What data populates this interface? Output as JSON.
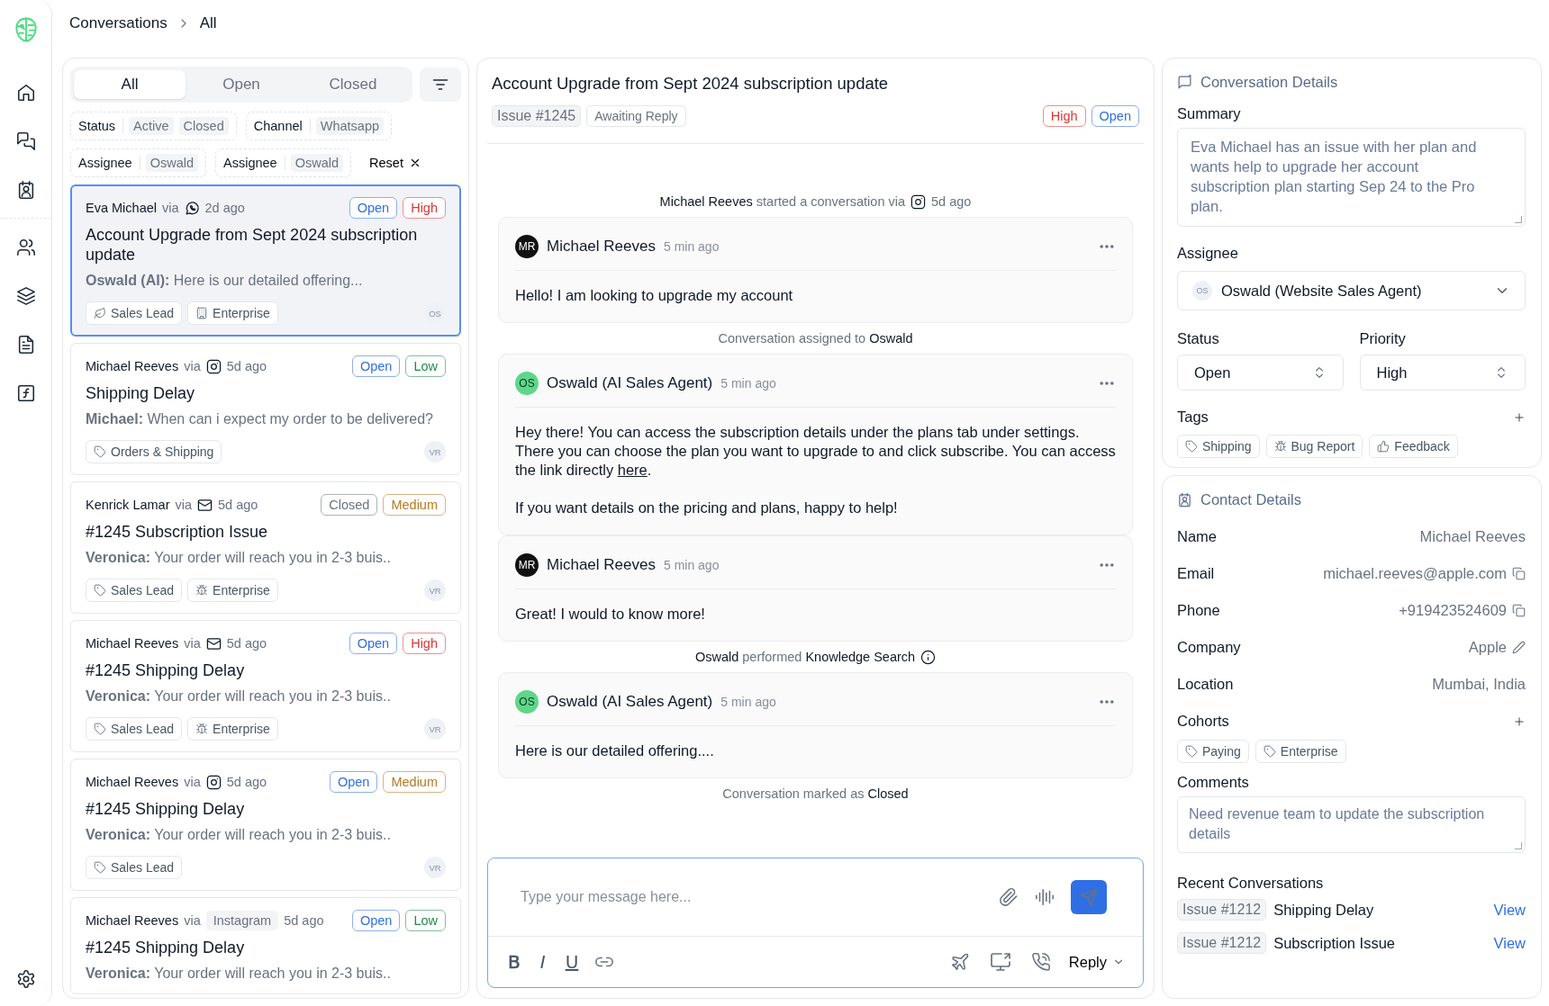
{
  "breadcrumb": [
    "Conversations",
    "All"
  ],
  "list": {
    "tabs": [
      {
        "label": "All",
        "selected": true
      },
      {
        "label": "Open",
        "selected": false
      },
      {
        "label": "Closed",
        "selected": false
      }
    ],
    "filters": [
      {
        "label": "Status",
        "values": [
          "Active",
          "Closed"
        ]
      },
      {
        "label": "Channel",
        "values": [
          "Whatsapp"
        ]
      },
      {
        "label": "Assignee",
        "values": [
          "Oswald"
        ]
      },
      {
        "label": "Assignee",
        "values": [
          "Oswald"
        ]
      }
    ],
    "reset": "Reset",
    "conversations": [
      {
        "name": "Eva Michael",
        "via": "via",
        "channel": {
          "kind": "whatsapp"
        },
        "time": "2d ago",
        "badges": [
          {
            "label": "Open",
            "color": "#2f6fe4"
          },
          {
            "label": "High",
            "color": "#dc3535"
          }
        ],
        "title": "Account Upgrade from Sept 2024 subscription update",
        "preview": "**Oswald (AI):** Here is our detailed offering...",
        "tags": [
          {
            "kind": "leaf",
            "label": "Sales Lead"
          },
          {
            "kind": "building",
            "label": "Enterprise"
          }
        ],
        "avatar": "OS",
        "selected": true
      },
      {
        "name": "Michael Reeves",
        "via": "via",
        "channel": {
          "kind": "instagram"
        },
        "time": "5d ago",
        "badges": [
          {
            "label": "Open",
            "color": "#2f6fe4"
          },
          {
            "label": "Low",
            "color": "#1f8a4c"
          }
        ],
        "title": "Shipping Delay",
        "preview": "**Michael:** When can i expect my order to be delivered?",
        "tags": [
          {
            "kind": "tag",
            "label": "Orders & Shipping"
          }
        ],
        "avatar": "VR",
        "selected": false
      },
      {
        "name": "Kenrick Lamar",
        "via": "via",
        "channel": {
          "kind": "mail"
        },
        "time": "5d ago",
        "badges": [
          {
            "label": "Closed",
            "color": "#6b7280"
          },
          {
            "label": "Medium",
            "color": "#b7791f"
          }
        ],
        "title": "#1245 Subscription Issue",
        "preview": "**Veronica:** Your order will reach you in 2-3 buis..",
        "tags": [
          {
            "kind": "tag",
            "label": "Sales Lead"
          },
          {
            "kind": "bug",
            "label": "Enterprise"
          }
        ],
        "avatar": "VR",
        "selected": false
      },
      {
        "name": "Michael Reeves",
        "via": "via",
        "channel": {
          "kind": "mail"
        },
        "time": "5d ago",
        "badges": [
          {
            "label": "Open",
            "color": "#2f6fe4"
          },
          {
            "label": "High",
            "color": "#dc3535"
          }
        ],
        "title": "#1245 Shipping Delay",
        "preview": "**Veronica:** Your order will reach you in 2-3 buis..",
        "tags": [
          {
            "kind": "tag",
            "label": "Sales Lead"
          },
          {
            "kind": "bug",
            "label": "Enterprise"
          }
        ],
        "avatar": "VR",
        "selected": false
      },
      {
        "name": "Michael Reeves",
        "via": "via",
        "channel": {
          "kind": "instagram"
        },
        "time": "5d ago",
        "badges": [
          {
            "label": "Open",
            "color": "#2f6fe4"
          },
          {
            "label": "Medium",
            "color": "#b7791f"
          }
        ],
        "title": "#1245 Shipping Delay",
        "preview": "**Veronica:** Your order will reach you in 2-3 buis..",
        "tags": [
          {
            "kind": "tag",
            "label": "Sales Lead"
          }
        ],
        "avatar": "VR",
        "selected": false
      },
      {
        "name": "Michael Reeves",
        "via": "via",
        "channel": {
          "kind": "label",
          "label": "Instagram"
        },
        "time": "5d ago",
        "badges": [
          {
            "label": "Open",
            "color": "#2f6fe4"
          },
          {
            "label": "Low",
            "color": "#1f8a4c"
          }
        ],
        "title": "#1245 Shipping Delay",
        "preview": "**Veronica:** Your order will reach you in 2-3 buis..",
        "selected": false
      }
    ]
  },
  "thread": {
    "title": "Account Upgrade from Sept 2024 subscription update",
    "issue": "Issue #1245",
    "state": "Awaiting Reply",
    "badges": [
      {
        "label": "High",
        "color": "#dc3535"
      },
      {
        "label": "Open",
        "color": "#2f6fe4"
      }
    ],
    "items": [
      {
        "kind": "event",
        "text": "**Michael Reeves** started a conversation via",
        "mark": {
          "kind": "instagram"
        },
        "after": "5d ago"
      },
      {
        "kind": "message",
        "initials": "MR",
        "color": "#111111",
        "author": "Michael Reeves",
        "time": "5 min ago",
        "paragraphs": [
          [
            {
              "text": "Hello! I am looking to upgrade my account",
              "link": false
            }
          ]
        ]
      },
      {
        "kind": "event",
        "text": "Conversation assigned to **Oswald**"
      },
      {
        "kind": "message",
        "initials": "OS",
        "color": "#5fd68a",
        "author": "Oswald (AI Sales Agent)",
        "time": "5 min ago",
        "paragraphs": [
          [
            {
              "text": "Hey there! You can access the subscription details under the plans tab under settings. There you can choose the plan you want to upgrade to and click subscribe. You can access the link directly ",
              "link": false
            },
            {
              "text": "here",
              "link": true
            },
            {
              "text": ".",
              "link": false
            }
          ],
          [
            {
              "text": "If you want details on the pricing and plans, happy to help!",
              "link": false
            }
          ]
        ]
      },
      {
        "kind": "message",
        "initials": "MR",
        "color": "#111111",
        "author": "Michael Reeves",
        "time": "5 min ago",
        "paragraphs": [
          [
            {
              "text": "Great! I would to know more!",
              "link": false
            }
          ]
        ]
      },
      {
        "kind": "event",
        "text": "**Oswald** performed **Knowledge Search**",
        "mark": {
          "kind": "info"
        }
      },
      {
        "kind": "message",
        "initials": "OS",
        "color": "#5fd68a",
        "author": "Oswald (AI Sales Agent)",
        "time": "5 min ago",
        "paragraphs": [
          [
            {
              "text": "Here is our detailed offering....",
              "link": false
            }
          ]
        ]
      },
      {
        "kind": "event",
        "text": "Conversation marked as **Closed**"
      }
    ],
    "composer": {
      "placeholder": "Type your message here...",
      "format": [
        {
          "kind": "bold",
          "label": "B"
        },
        {
          "kind": "italic",
          "label": "I"
        },
        {
          "kind": "underline",
          "label": "U"
        }
      ],
      "mode": "Reply"
    }
  },
  "details": {
    "title": "Conversation Details",
    "summary_label": "Summary",
    "summary": "Eva Michael has an issue with her plan and wants help to upgrade her account subscription plan starting Sep 24 to the Pro plan.",
    "assignee_label": "Assignee",
    "assignee": {
      "initials": "OS",
      "value": "Oswald (Website Sales Agent)"
    },
    "status_label": "Status",
    "status": "Open",
    "priority_label": "Priority",
    "priority": "High",
    "tags_label": "Tags",
    "tags": [
      {
        "kind": "tag",
        "label": "Shipping"
      },
      {
        "kind": "bug",
        "label": "Bug Report"
      },
      {
        "kind": "thumb",
        "label": "Feedback"
      }
    ]
  },
  "contact": {
    "title": "Contact Details",
    "fields": [
      {
        "kind": "plain",
        "label": "Name",
        "value": "Michael Reeves"
      },
      {
        "kind": "copy",
        "label": "Email",
        "value": "michael.reeves@apple.com"
      },
      {
        "kind": "copy",
        "label": "Phone",
        "value": "+919423524609"
      },
      {
        "kind": "edit",
        "label": "Company",
        "value": "Apple"
      },
      {
        "kind": "plain",
        "label": "Location",
        "value": "Mumbai, India"
      }
    ],
    "cohorts_label": "Cohorts",
    "cohorts": [
      {
        "kind": "tag",
        "label": "Paying"
      },
      {
        "kind": "tag",
        "label": "Enterprise"
      }
    ],
    "comments_label": "Comments",
    "comments": "Need revenue team to update the subscription details",
    "recent_label": "Recent Conversations",
    "recent": [
      {
        "issue": "Issue #1212",
        "title": "Shipping Delay",
        "link": "View"
      },
      {
        "issue": "Issue #1212",
        "title": "Subscription Issue",
        "link": "View"
      }
    ]
  }
}
